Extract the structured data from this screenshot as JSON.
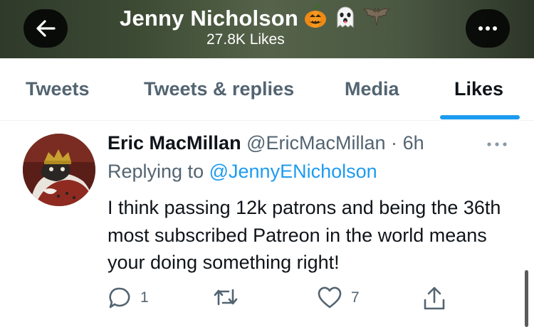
{
  "header": {
    "name": "Jenny Nicholson",
    "emojis": [
      "🎃",
      "👻",
      "🦇"
    ],
    "likes_count": "27.8K Likes"
  },
  "tabs": [
    {
      "label": "Tweets"
    },
    {
      "label": "Tweets & replies"
    },
    {
      "label": "Media"
    },
    {
      "label": "Likes",
      "active": true
    }
  ],
  "tweet": {
    "author_name": "Eric MacMillan",
    "author_handle": "@EricMacMillan",
    "separator": "·",
    "time": "6h",
    "replying_prefix": "Replying to",
    "replying_handle": "@JennyENicholson",
    "text": "I think passing 12k patrons and being the 36th most subscribed Patreon in the world means your doing something right!",
    "reply_count": "1",
    "retweet_count": "",
    "like_count": "7"
  },
  "colors": {
    "accent": "#1d9bf0",
    "secondary_text": "#536471",
    "primary_text": "#0f1419"
  }
}
